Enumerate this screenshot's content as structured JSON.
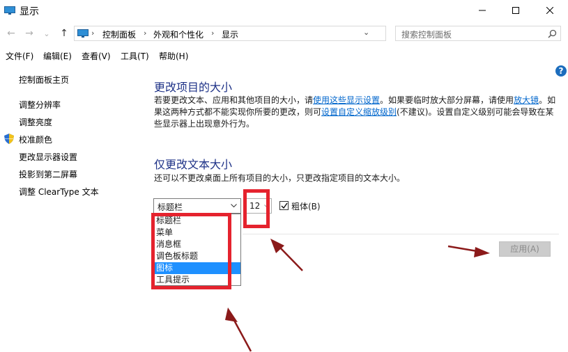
{
  "window": {
    "title": "显示",
    "minimize": "—",
    "maximize": "☐",
    "close": "✕"
  },
  "nav": {
    "back": "←",
    "forward": "→",
    "recent": "⌄",
    "up": "↑"
  },
  "address": {
    "crumbs": [
      "控制面板",
      "外观和个性化",
      "显示"
    ],
    "separator": "›",
    "dropdown": "⌄",
    "refresh": "↻"
  },
  "search": {
    "placeholder": "搜索控制面板",
    "icon": "search-icon"
  },
  "menu": [
    "文件(F)",
    "编辑(E)",
    "查看(V)",
    "工具(T)",
    "帮助(H)"
  ],
  "help": "?",
  "sidebar": {
    "home": "控制面板主页",
    "links": [
      "调整分辨率",
      "调整亮度",
      "校准颜色",
      "更改显示器设置",
      "投影到第二屏幕",
      "调整 ClearType 文本"
    ]
  },
  "section1": {
    "title": "更改项目的大小",
    "line1_a": "若要更改文本、应用和其他项目的大小，请",
    "line1_link": "使用这些显示设置",
    "line1_b": "。如果要临时放大部分屏幕，请使用",
    "line1_link2": "放大镜",
    "line1_c": "。如",
    "line2_a": "果这两种方式都不能实现你所要的更改，则可",
    "line2_link": "设置自定义缩放级别",
    "line2_b": "(不建议)。设置自定义级别可能会导致在某",
    "line3": "些显示器上出现意外行为。"
  },
  "section2": {
    "title": "仅更改文本大小",
    "description": "还可以不更改桌面上所有项目的大小，只更改指定项目的文本大小。",
    "element_value": "标题栏",
    "size_value": "12",
    "bold_label": "粗体(B)",
    "bold_checked": "✓",
    "options": [
      "标题栏",
      "菜单",
      "消息框",
      "调色板标题",
      "图标",
      "工具提示"
    ],
    "selected_option": "图标",
    "apply_label": "应用(A)"
  },
  "colors": {
    "heading": "#1e3287",
    "link": "#0066cc",
    "selection": "#1e90ff",
    "annotation_red": "#e5232e",
    "annotation_arrow": "#8b1a1a"
  }
}
